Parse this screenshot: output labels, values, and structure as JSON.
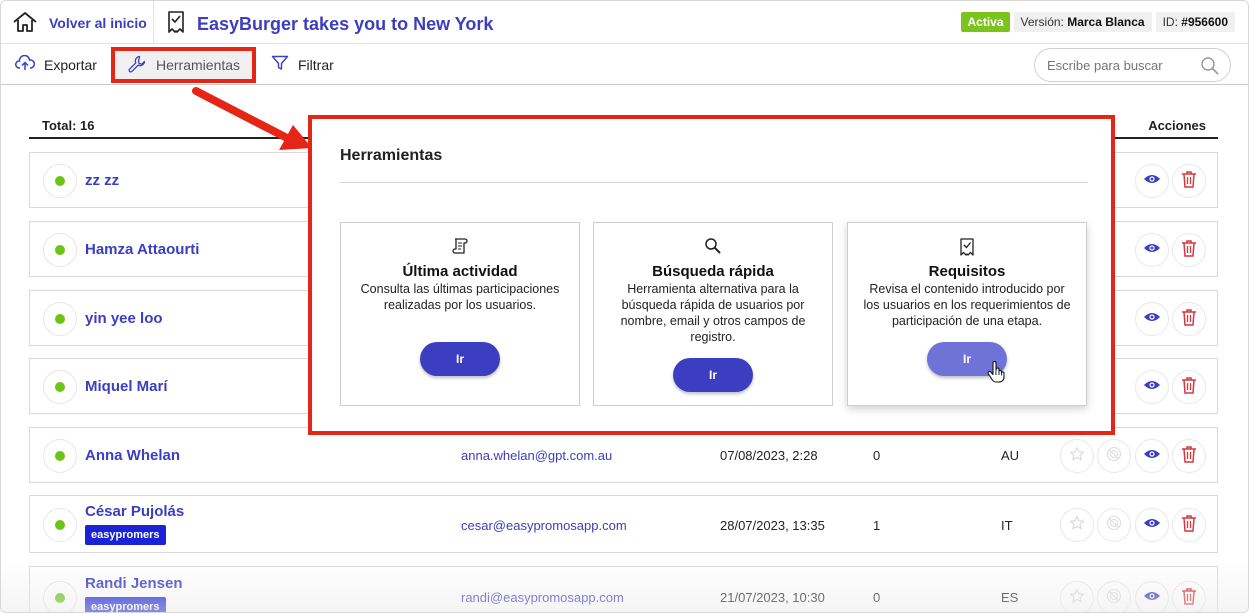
{
  "topbar": {
    "home_label": "Volver al inicio",
    "app_title": "EasyBurger takes you to New York",
    "status": "Activa",
    "version_label": "Versión:",
    "version_value": "Marca Blanca",
    "id_label": "ID:",
    "id_value": "#956600"
  },
  "toolbar": {
    "export_label": "Exportar",
    "tools_label": "Herramientas",
    "filter_label": "Filtrar",
    "search_placeholder": "Escribe para buscar"
  },
  "list": {
    "total_label": "Total: 16",
    "actions_header": "Acciones",
    "rows": [
      {
        "name": "zz zz",
        "tag": "",
        "email": "",
        "date": "",
        "count": "",
        "country": ""
      },
      {
        "name": "Hamza Attaourti",
        "tag": "",
        "email": "",
        "date": "",
        "count": "",
        "country": ""
      },
      {
        "name": "yin yee loo",
        "tag": "",
        "email": "",
        "date": "",
        "count": "",
        "country": ""
      },
      {
        "name": "Miquel Marí",
        "tag": "",
        "email": "",
        "date": "",
        "count": "",
        "country": ""
      },
      {
        "name": "Anna Whelan",
        "tag": "",
        "email": "anna.whelan@gpt.com.au",
        "date": "07/08/2023, 2:28",
        "count": "0",
        "country": "AU"
      },
      {
        "name": "César Pujolás",
        "tag": "easypromers",
        "email": "cesar@easypromosapp.com",
        "date": "28/07/2023, 13:35",
        "count": "1",
        "country": "IT"
      },
      {
        "name": "Randi Jensen",
        "tag": "easypromers",
        "email": "randi@easypromosapp.com",
        "date": "21/07/2023, 10:30",
        "count": "0",
        "country": "ES"
      }
    ]
  },
  "popup": {
    "title": "Herramientas",
    "cards": [
      {
        "title": "Última actividad",
        "description": "Consulta las últimas participaciones realizadas por los usuarios.",
        "button": "Ir",
        "icon": "scroll-icon"
      },
      {
        "title": "Búsqueda rápida",
        "description": "Herramienta alternativa para la búsqueda rápida de usuarios por nombre, email y otros campos de registro.",
        "button": "Ir",
        "icon": "magnifier-icon"
      },
      {
        "title": "Requisitos",
        "description": "Revisa el contenido introducido por los usuarios en los requerimientos de participación de una etapa.",
        "button": "Ir",
        "icon": "ribbon-icon"
      }
    ]
  },
  "colors": {
    "brand": "#3b3ec1",
    "active_badge": "#7bc41e",
    "status_dot": "#6ac517",
    "annotation_red": "#e52515",
    "tag_bg": "#1a24d6",
    "delete": "#d9363e"
  }
}
